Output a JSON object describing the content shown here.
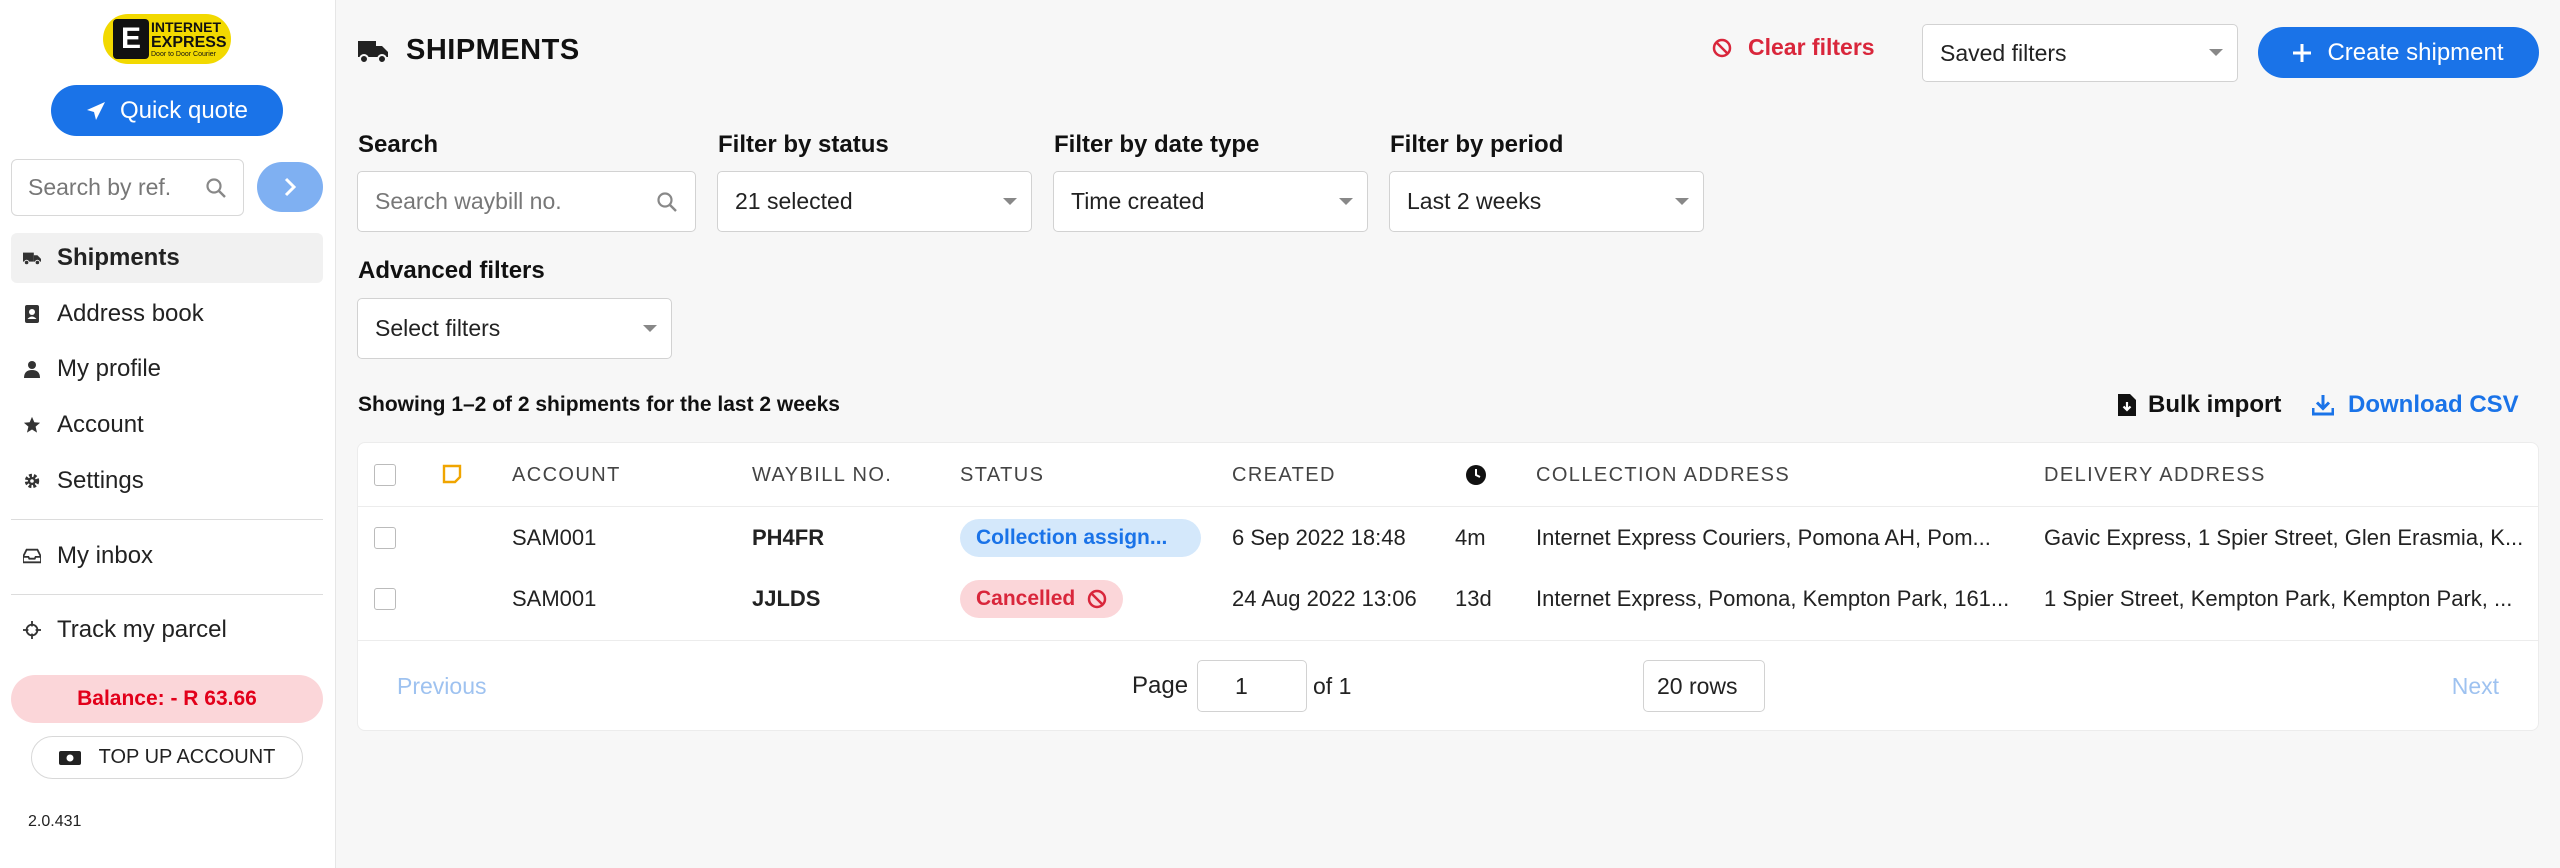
{
  "brand": {
    "logo_letter": "E",
    "logo_line1": "INTERNET",
    "logo_line2": "EXPRESS",
    "logo_tagline": "Door to Door Courier"
  },
  "sidebar": {
    "quick_quote_label": "Quick quote",
    "ref_search_placeholder": "Search by ref.",
    "nav_items": [
      {
        "label": "Shipments",
        "icon": "truck-icon",
        "active": true
      },
      {
        "label": "Address book",
        "icon": "contact-book-icon"
      },
      {
        "label": "My profile",
        "icon": "user-icon"
      },
      {
        "label": "Account",
        "icon": "star-icon"
      },
      {
        "label": "Settings",
        "icon": "gear-icon"
      },
      {
        "label": "My inbox",
        "icon": "inbox-icon"
      },
      {
        "label": "Track my parcel",
        "icon": "crosshair-icon"
      }
    ],
    "balance_text": "Balance: - R 63.66",
    "top_up_label": "TOP UP ACCOUNT",
    "version": "2.0.431"
  },
  "header": {
    "title": "SHIPMENTS",
    "clear_filters_label": "Clear filters",
    "saved_filters_value": "Saved filters",
    "create_shipment_label": "Create shipment"
  },
  "filters": {
    "search_label": "Search",
    "search_placeholder": "Search waybill no.",
    "status_label": "Filter by status",
    "status_value": "21 selected",
    "date_type_label": "Filter by date type",
    "date_type_value": "Time created",
    "period_label": "Filter by period",
    "period_value": "Last 2 weeks",
    "advanced_label": "Advanced filters",
    "advanced_value": "Select filters"
  },
  "summary": {
    "showing_text": "Showing 1–2 of 2 shipments for the last 2 weeks",
    "bulk_import_label": "Bulk import",
    "download_csv_label": "Download CSV"
  },
  "table": {
    "columns": [
      "ACCOUNT",
      "WAYBILL NO.",
      "STATUS",
      "CREATED",
      "COLLECTION ADDRESS",
      "DELIVERY ADDRESS"
    ],
    "rows": [
      {
        "account": "SAM001",
        "waybill": "PH4FR",
        "status": "Collection assign...",
        "created": "6 Sep 2022 18:48",
        "age": "4m",
        "collection": "Internet Express Couriers, Pomona AH, Pom...",
        "delivery": "Gavic Express, 1 Spier Street, Glen Erasmia, K..."
      },
      {
        "account": "SAM001",
        "waybill": "JJLDS",
        "status": "Cancelled",
        "created": "24 Aug 2022 13:06",
        "age": "13d",
        "collection": "Internet Express, Pomona, Kempton Park, 161...",
        "delivery": "1 Spier Street, Kempton Park, Kempton Park, ..."
      }
    ]
  },
  "pagination": {
    "previous_label": "Previous",
    "page_label": "Page",
    "page_value": "1",
    "of_label": "of 1",
    "rows_value": "20 rows",
    "next_label": "Next"
  },
  "colors": {
    "primary": "#1a73e8",
    "danger": "#d9263b",
    "balance_bg": "#fbd6d9",
    "brand_yellow": "#f2d900"
  }
}
